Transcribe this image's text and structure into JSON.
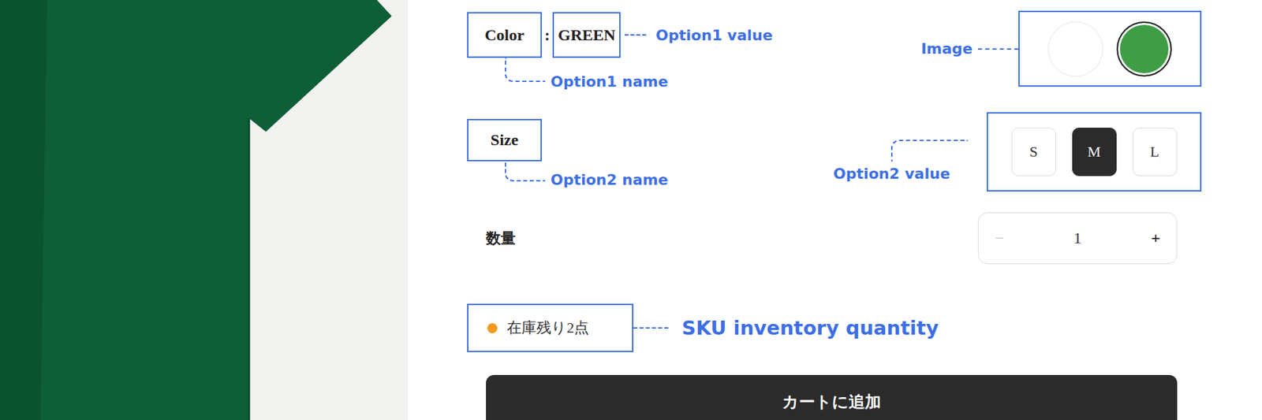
{
  "option1": {
    "name": "Color",
    "separator": ":",
    "value": "GREEN",
    "swatches": [
      {
        "color": "#ffffff",
        "selected": false
      },
      {
        "color": "#3f9e45",
        "selected": true
      }
    ]
  },
  "option2": {
    "name": "Size",
    "values": [
      {
        "label": "S",
        "selected": false
      },
      {
        "label": "M",
        "selected": true
      },
      {
        "label": "L",
        "selected": false
      }
    ]
  },
  "quantity": {
    "label": "数量",
    "minus": "−",
    "value": "1",
    "plus": "+"
  },
  "stock": {
    "text": "在庫残り2点",
    "color": "#f39a1e"
  },
  "cart_button": {
    "label": "カートに追加"
  },
  "annotations": {
    "option1_value": "Option1 value",
    "option1_name": "Option1 name",
    "image": "Image",
    "option2_name": "Option2 name",
    "option2_value": "Option2 value",
    "sku": "SKU inventory quantity"
  }
}
